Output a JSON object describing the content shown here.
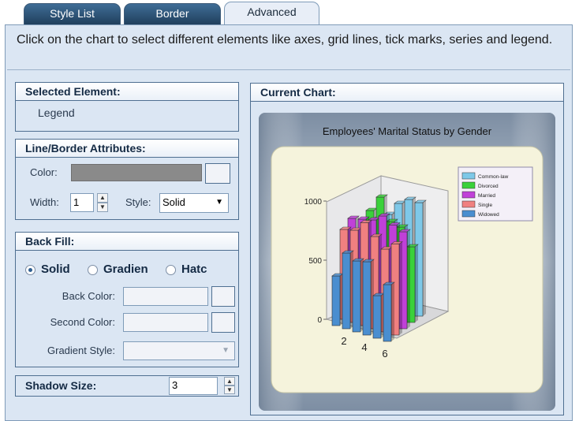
{
  "tabs": [
    {
      "label": "Style List"
    },
    {
      "label": "Border"
    },
    {
      "label": "Advanced"
    }
  ],
  "description": "Click on the chart to select different elements like axes, grid lines, tick marks, series and legend.",
  "selected_element": {
    "title": "Selected Element:",
    "value": "Legend"
  },
  "line_border": {
    "title": "Line/Border Attributes:",
    "color_label": "Color:",
    "width_label": "Width:",
    "width_value": "1",
    "style_label": "Style:",
    "style_value": "Solid"
  },
  "back_fill": {
    "title": "Back Fill:",
    "options": [
      "Solid",
      "Gradien",
      "Hatc"
    ],
    "selected": "Solid",
    "back_color_label": "Back Color:",
    "second_color_label": "Second Color:",
    "gradient_style_label": "Gradient Style:"
  },
  "shadow": {
    "label": "Shadow Size:",
    "value": "3"
  },
  "current_chart": {
    "title": "Current Chart:"
  },
  "chart_data": {
    "type": "bar",
    "title": "Employees' Marital Status by Gender",
    "ylim": [
      0,
      1000
    ],
    "yticks": [
      "0",
      "500",
      "1000"
    ],
    "xticks": [
      "2",
      "4",
      "6"
    ],
    "legend": [
      "Common-law",
      "Divorced",
      "Married",
      "Single",
      "Widowed"
    ],
    "legend_placement": "top-right",
    "colors": [
      "#7ec8e8",
      "#3ad13a",
      "#c040d8",
      "#f08080",
      "#4a8ed0"
    ]
  }
}
